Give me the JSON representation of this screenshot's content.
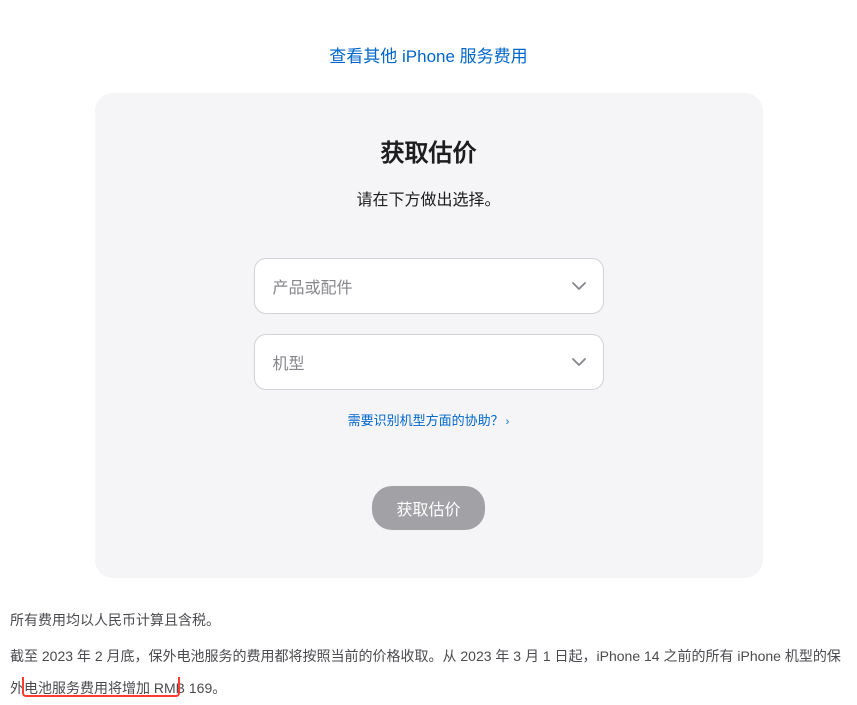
{
  "topLink": "查看其他 iPhone 服务费用",
  "card": {
    "title": "获取估价",
    "subtitle": "请在下方做出选择。",
    "select1Placeholder": "产品或配件",
    "select2Placeholder": "机型",
    "helpLink": "需要识别机型方面的协助？",
    "submitLabel": "获取估价"
  },
  "footnotes": {
    "line1": "所有费用均以人民币计算且含税。",
    "line2": "截至 2023 年 2 月底，保外电池服务的费用都将按照当前的价格收取。从 2023 年 3 月 1 日起，iPhone 14 之前的所有 iPhone 机型的保外电池服务费用将增加 RMB 169。"
  }
}
